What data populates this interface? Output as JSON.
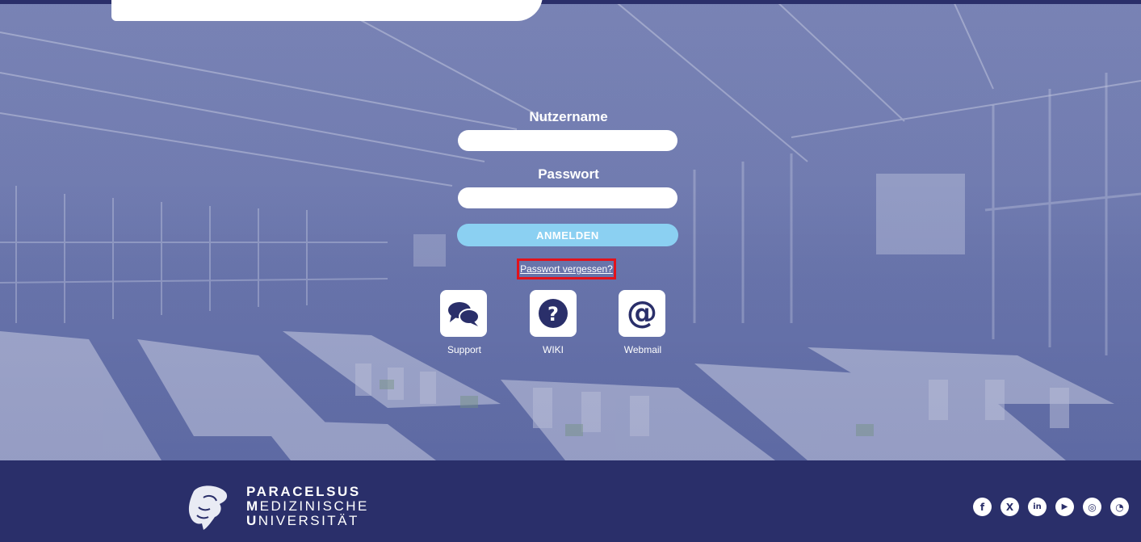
{
  "form": {
    "username_label": "Nutzername",
    "username_value": "",
    "password_label": "Passwort",
    "password_value": "",
    "submit_label": "ANMELDEN",
    "forgot_label": "Passwort vergessen?"
  },
  "quicklinks": [
    {
      "label": "Support",
      "icon": "chat-bubbles-icon"
    },
    {
      "label": "WIKI",
      "icon": "question-circle-icon"
    },
    {
      "label": "Webmail",
      "icon": "at-sign-icon"
    }
  ],
  "footer": {
    "brand_line1": "PARACELSUS",
    "brand_line2_initial": "M",
    "brand_line2_rest": "EDIZINISCHE",
    "brand_line3_initial": "U",
    "brand_line3_rest": "NIVERSITÄT",
    "socials": [
      {
        "name": "facebook-icon",
        "glyph": "f"
      },
      {
        "name": "xing-icon",
        "glyph": "X"
      },
      {
        "name": "linkedin-icon",
        "glyph": "in"
      },
      {
        "name": "youtube-icon",
        "glyph": "▶"
      },
      {
        "name": "instagram-icon",
        "glyph": "◎"
      },
      {
        "name": "rss-icon",
        "glyph": "◔"
      }
    ]
  },
  "colors": {
    "navy": "#2a2f6a",
    "button": "#8bd0f2",
    "highlight": "#e3121b"
  }
}
